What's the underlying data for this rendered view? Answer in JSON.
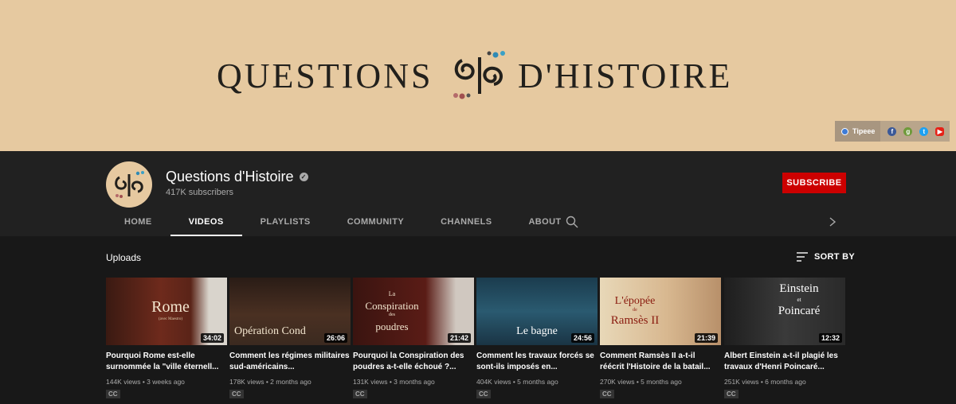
{
  "banner": {
    "word_left": "QUESTIONS",
    "word_right": "D'HISTOIRE",
    "links": {
      "tipeee": "Tipeee",
      "icons": [
        "facebook-icon",
        "google-plus-icon",
        "twitter-icon",
        "youtube-icon"
      ]
    },
    "colors": {
      "background": "#e6c9a0",
      "text": "#22201c"
    }
  },
  "channel": {
    "name": "Questions d'Histoire",
    "subscribers": "417K subscribers",
    "subscribe_label": "SUBSCRIBE"
  },
  "tabs": [
    {
      "label": "HOME",
      "active": false
    },
    {
      "label": "VIDEOS",
      "active": true
    },
    {
      "label": "PLAYLISTS",
      "active": false
    },
    {
      "label": "COMMUNITY",
      "active": false
    },
    {
      "label": "CHANNELS",
      "active": false
    },
    {
      "label": "ABOUT",
      "active": false
    }
  ],
  "section": {
    "title": "Uploads",
    "sort_label": "SORT BY"
  },
  "videos": [
    {
      "title": "Pourquoi Rome est-elle surnommée la \"ville éternell...",
      "duration": "34:02",
      "views": "144K views",
      "age": "3 weeks ago",
      "cc": "CC",
      "thumb_lines": [
        "Rome",
        "(avec Maestro)"
      ]
    },
    {
      "title": "Comment les régimes militaires sud-américains...",
      "duration": "26:06",
      "views": "178K views",
      "age": "2 months ago",
      "cc": "CC",
      "thumb_lines": [
        "Opération Cond"
      ]
    },
    {
      "title": "Pourquoi la Conspiration des poudres a-t-elle échoué ?...",
      "duration": "21:42",
      "views": "131K views",
      "age": "3 months ago",
      "cc": "CC",
      "thumb_lines": [
        "La",
        "Conspiration",
        "des",
        "poudres"
      ]
    },
    {
      "title": "Comment les travaux forcés se sont-ils imposés en...",
      "duration": "24:56",
      "views": "404K views",
      "age": "5 months ago",
      "cc": "CC",
      "thumb_lines": [
        "Le bagne"
      ]
    },
    {
      "title": "Comment Ramsès II a-t-il réécrit l'Histoire de la batail...",
      "duration": "21:39",
      "views": "270K views",
      "age": "5 months ago",
      "cc": "CC",
      "thumb_lines": [
        "L'épopée",
        "de",
        "Ramsès II"
      ]
    },
    {
      "title": "Albert Einstein a-t-il plagié les travaux d'Henri Poincaré...",
      "duration": "12:32",
      "views": "251K views",
      "age": "6 months ago",
      "cc": "CC",
      "thumb_lines": [
        "Einstein",
        "et",
        "Poincaré"
      ]
    }
  ],
  "colors": {
    "accent": "#cc0000",
    "header_bg": "#212121",
    "page_bg": "#181818"
  }
}
